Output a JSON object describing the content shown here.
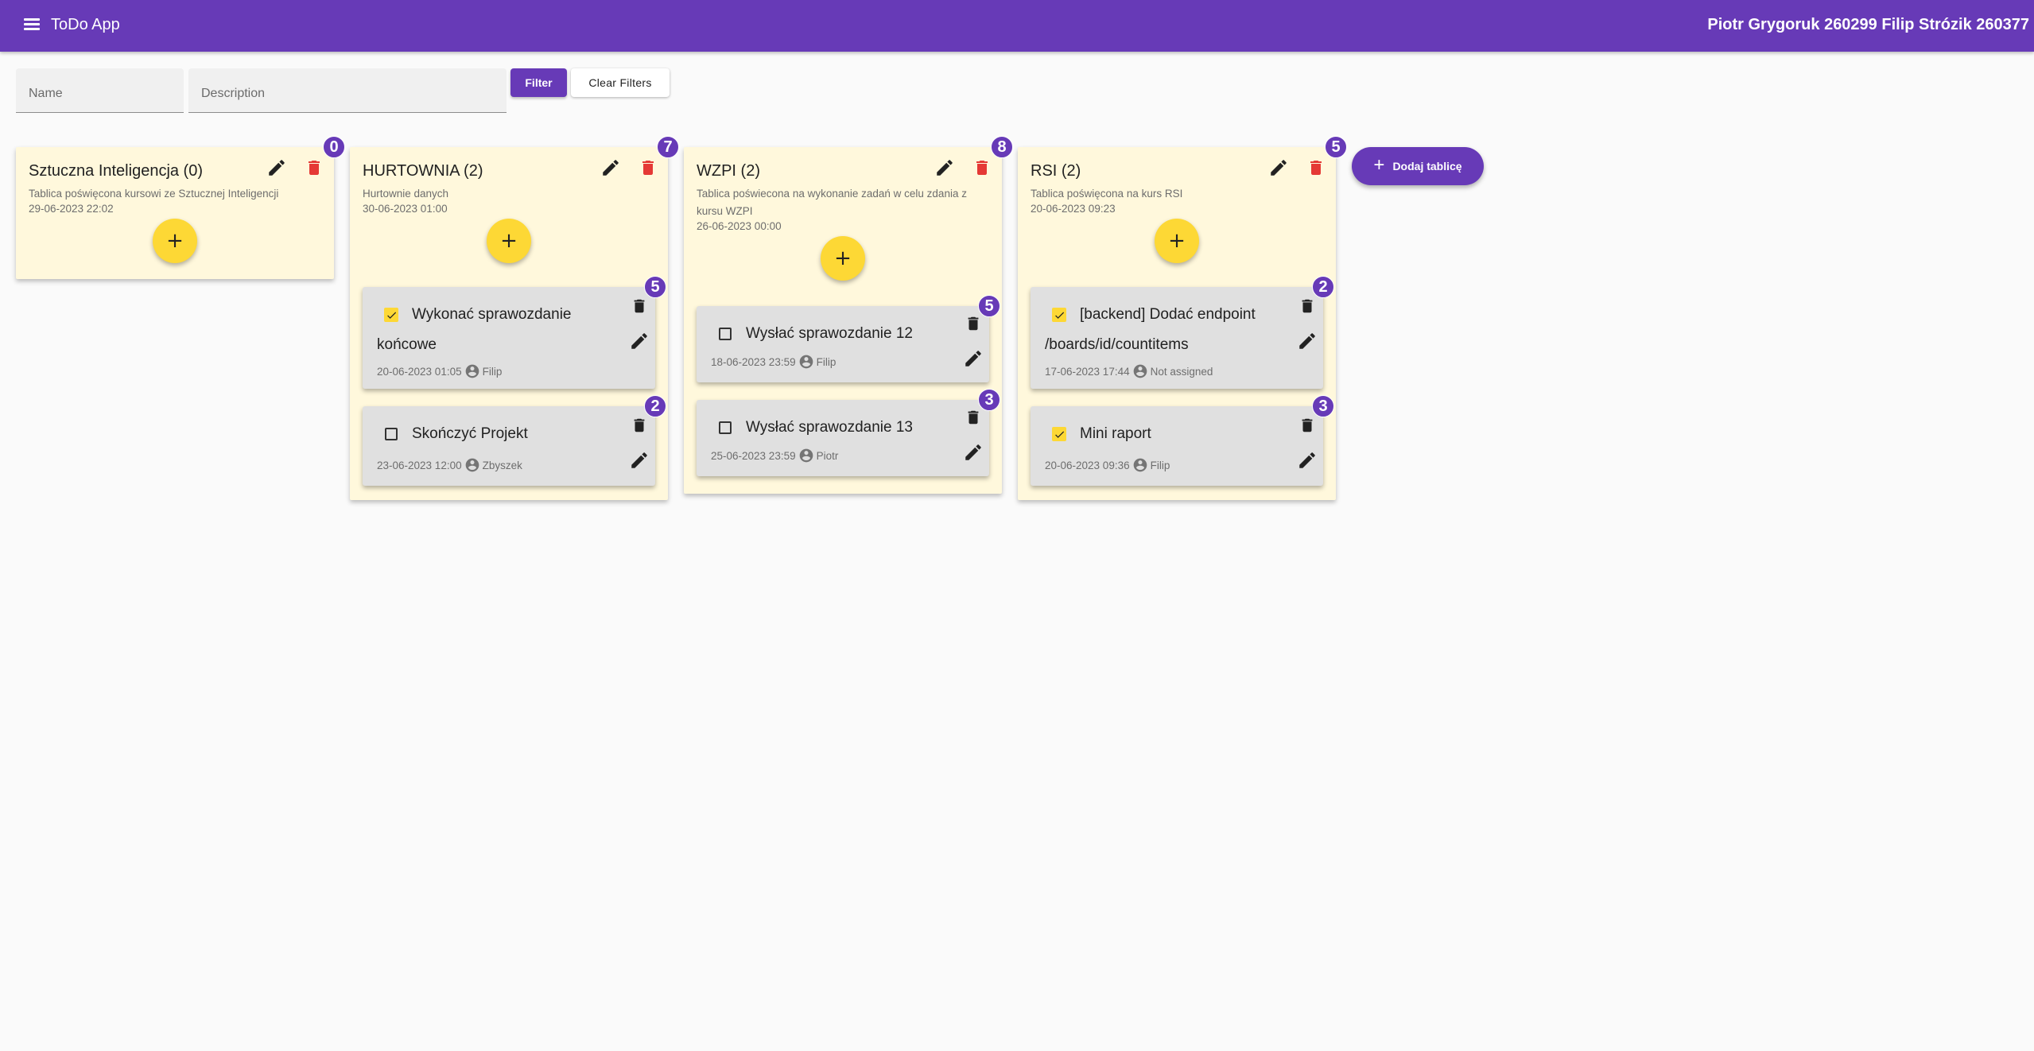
{
  "app": {
    "title": "ToDo App",
    "authors": "Piotr Grygoruk 260299  Filip Strózik 260377"
  },
  "filters": {
    "name_placeholder": "Name",
    "description_placeholder": "Description",
    "filter_label": "Filter",
    "clear_label": "Clear Filters"
  },
  "add_board_label": "Dodaj tablicę",
  "add_board_icon": "+",
  "add_task_icon": "+",
  "colors": {
    "primary": "#673ab7",
    "accent": "#fdd835",
    "board_bg": "#fff8dc",
    "task_bg": "#e0e0e0",
    "delete_red": "#e53935"
  },
  "boards": [
    {
      "title": "Sztuczna Inteligencja (0)",
      "description": "Tablica poświęcona kursowi ze Sztucznej Inteligencji",
      "date": "29-06-2023 22:02",
      "badge": "0",
      "tasks": []
    },
    {
      "title": "HURTOWNIA (2)",
      "description": "Hurtownie danych",
      "date": "30-06-2023 01:00",
      "badge": "7",
      "tasks": [
        {
          "title": "Wykonać sprawozdanie końcowe",
          "checked": true,
          "date": "20-06-2023 01:05",
          "assignee": "Filip",
          "badge": "5"
        },
        {
          "title": "Skończyć Projekt",
          "checked": false,
          "date": "23-06-2023 12:00",
          "assignee": "Zbyszek",
          "badge": "2"
        }
      ]
    },
    {
      "title": "WZPI (2)",
      "description": "Tablica poświecona na wykonanie zadań w celu zdania z kursu WZPI",
      "date": "26-06-2023 00:00",
      "badge": "8",
      "tasks": [
        {
          "title": "Wysłać sprawozdanie 12",
          "checked": false,
          "date": "18-06-2023 23:59",
          "assignee": "Filip",
          "badge": "5"
        },
        {
          "title": "Wysłać sprawozdanie 13",
          "checked": false,
          "date": "25-06-2023 23:59",
          "assignee": "Piotr",
          "badge": "3"
        }
      ]
    },
    {
      "title": "RSI (2)",
      "description": "Tablica poświęcona na kurs RSI",
      "date": "20-06-2023 09:23",
      "badge": "5",
      "tasks": [
        {
          "title": "[backend] Dodać endpoint /boards/id/countitems",
          "checked": true,
          "date": "17-06-2023 17:44",
          "assignee": "Not assigned",
          "badge": "2"
        },
        {
          "title": "Mini raport",
          "checked": true,
          "date": "20-06-2023 09:36",
          "assignee": "Filip",
          "badge": "3"
        }
      ]
    }
  ]
}
